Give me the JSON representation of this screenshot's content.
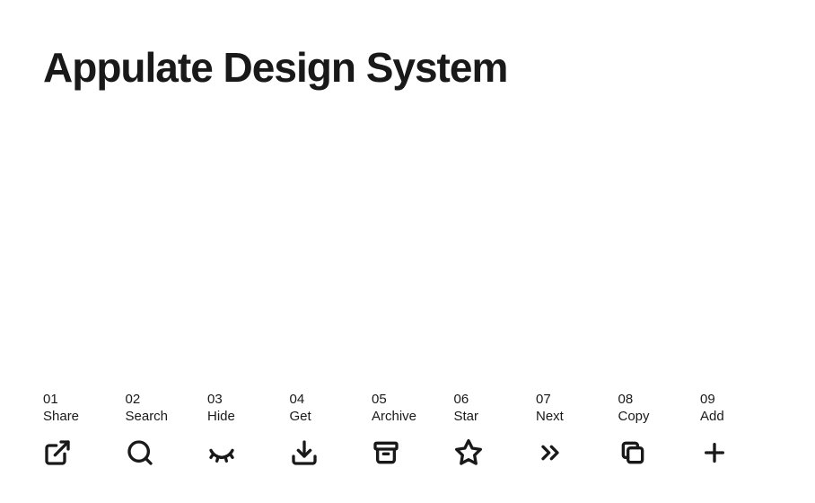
{
  "title": "Appulate Design System",
  "icons": [
    {
      "number": "01",
      "label": "Share"
    },
    {
      "number": "02",
      "label": "Search"
    },
    {
      "number": "03",
      "label": "Hide"
    },
    {
      "number": "04",
      "label": "Get"
    },
    {
      "number": "05",
      "label": "Archive"
    },
    {
      "number": "06",
      "label": "Star"
    },
    {
      "number": "07",
      "label": "Next"
    },
    {
      "number": "08",
      "label": "Copy"
    },
    {
      "number": "09",
      "label": "Add"
    }
  ]
}
